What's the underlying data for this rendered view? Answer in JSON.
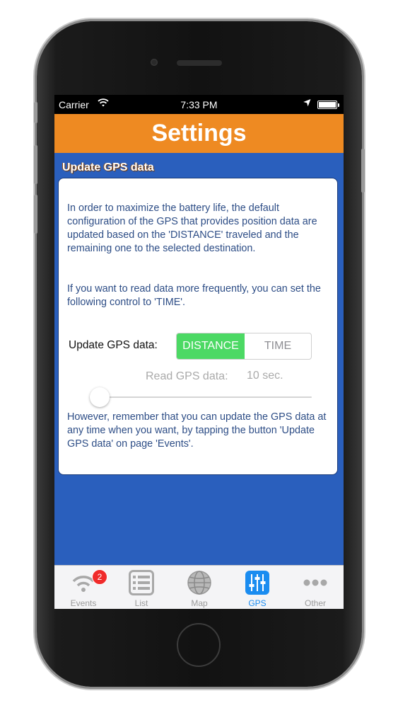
{
  "status_bar": {
    "carrier": "Carrier",
    "time": "7:33 PM"
  },
  "nav": {
    "title": "Settings"
  },
  "section": {
    "title": "Update GPS data"
  },
  "card": {
    "intro": "In order to maximize the battery life, the default configuration of the GPS that provides position data are updated based on the 'DISTANCE' traveled and the remaining one to the selected destination.",
    "frequency": "If you want to read data more frequently, you can set the following control to 'TIME'.",
    "update_label": "Update GPS data:",
    "segments": [
      "DISTANCE",
      "TIME"
    ],
    "selected_segment": "DISTANCE",
    "read_label": "Read GPS data:",
    "read_value": "10 sec.",
    "slider_value": 0.0,
    "note": "However, remember that you can update the GPS data at any time when you want, by tapping the button 'Update GPS data' on page 'Events'."
  },
  "tab_bar": {
    "events": {
      "label": "Events",
      "icon": "wifi-icon",
      "badge": "2"
    },
    "list": {
      "label": "List",
      "icon": "list-icon"
    },
    "map": {
      "label": "Map",
      "icon": "globe-icon"
    },
    "gps": {
      "label": "GPS",
      "icon": "sliders-icon"
    },
    "other": {
      "label": "Other",
      "icon": "more-icon"
    },
    "active": "GPS"
  },
  "colors": {
    "nav": "#ee8a22",
    "background": "#2a5fbd",
    "segment_selected": "#4cd964",
    "tab_active": "#1a8cf0",
    "badge": "#f02b2b"
  }
}
